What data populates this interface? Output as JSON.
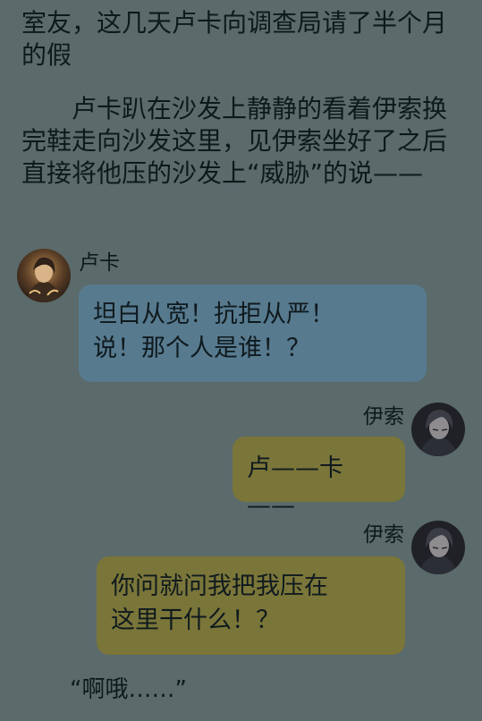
{
  "story": {
    "paragraph_1": "室友，这几天卢卡向调查局请了半个月的假",
    "paragraph_2": "卢卡趴在沙发上静静的看着伊索换完鞋走向沙发这里，见伊索坐好了之后直接将他压的沙发上“威胁”的说——"
  },
  "chat": [
    {
      "sender": "卢卡",
      "side": "left",
      "bubble_color": "#577a8f",
      "lines": [
        "坦白从宽！抗拒从严！",
        "说！那个人是谁！？"
      ]
    },
    {
      "sender": "伊索",
      "side": "right",
      "bubble_color": "#7a7539",
      "lines": [
        "卢——卡——"
      ]
    },
    {
      "sender": "伊索",
      "side": "right",
      "bubble_color": "#7a7539",
      "lines": [
        "你问就问我把我压在",
        "这里干什么！？"
      ]
    }
  ],
  "closing_line": "“啊哦……”",
  "colors": {
    "background": "#5b6a6b",
    "text": "#0d1a1a"
  },
  "icons": {
    "luka_avatar": "luka-avatar-icon",
    "isuo_avatar": "isuo-avatar-icon"
  }
}
